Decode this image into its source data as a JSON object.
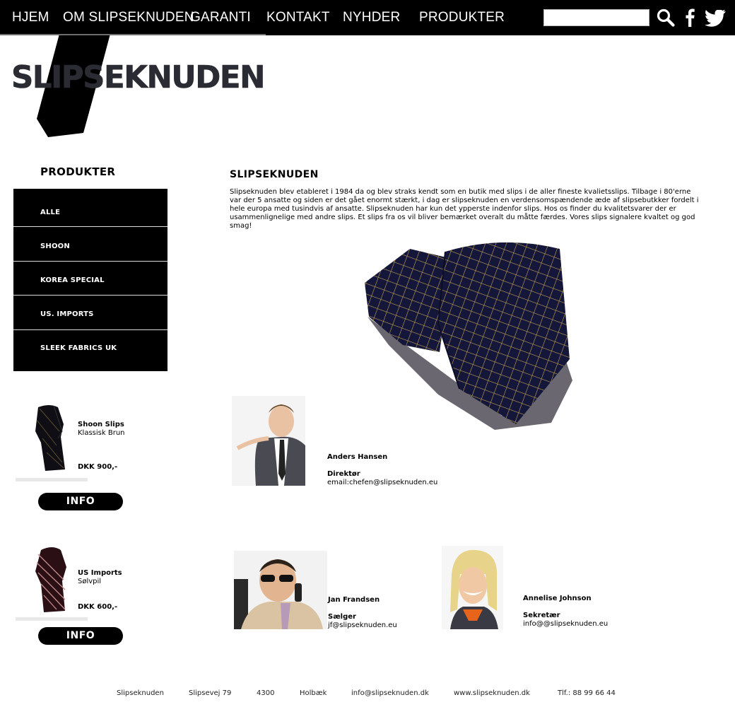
{
  "nav": {
    "items": [
      "HJEM",
      "OM SLIPSEKNUDEN",
      "GARANTI",
      "KONTAKT",
      "NYHDER",
      "PRODUKTER"
    ],
    "search_placeholder": "",
    "icons": [
      "search-icon",
      "facebook-icon",
      "twitter-icon"
    ]
  },
  "logo": {
    "text": "SLIPSEKNUDEN"
  },
  "sidebar": {
    "title": "PRODUKTER",
    "menu": [
      "ALLE",
      "SHOON",
      "KOREA SPECIAL",
      "US. IMPORTS",
      "SLEEK FABRICS UK"
    ],
    "products": [
      {
        "name": "Shoon Slips",
        "subtitle": "Klassisk Brun",
        "price": "DKK 900,-",
        "button": "INFO"
      },
      {
        "name": "US Imports",
        "subtitle": "Sølvpil",
        "price": "DKK 600,-",
        "button": "INFO"
      }
    ]
  },
  "main": {
    "title": "SLIPSEKNUDEN",
    "paragraph": "Slipseknuden blev etableret i 1984 da og blev straks kendt som en butik med slips i de aller fineste kvalietsslips. Tilbage i 80'erne var der 5 ansatte og siden er det gået enormt stærkt, i dag er slipseknuden en verdensomspændende æde af slipsebutkker fordelt i hele europa med tusindvis af ansatte. Slipseknuden har kun det ypperste indenfor slips. Hos os finder du kvalitetsvarer der er usammenlignelige med andre slips. Et slips fra os vil bliver bemærket overalt du måtte færdes. Vores slips signalere kvaltet og god smag!",
    "staff": [
      {
        "name": "Anders Hansen",
        "role": "Direktør",
        "email": "email:chefen@slipseknuden.eu"
      },
      {
        "name": "Jan Frandsen",
        "role": "Sælger",
        "email": "jf@slipseknuden.eu"
      },
      {
        "name": "Annelise Johnson",
        "role": "Sekretær",
        "email": "info@@slipseknuden.eu"
      }
    ]
  },
  "footer": [
    "Slipseknuden",
    "Slipsevej 79",
    "4300",
    "Holbæk",
    "info@slipseknuden.dk",
    "www.slipseknuden.dk",
    "Tlf.: 88 99 66 44"
  ],
  "colors": {
    "nav_bg": "#000000",
    "menu_bg": "#000000",
    "text": "#000000",
    "background": "#ffffff"
  }
}
